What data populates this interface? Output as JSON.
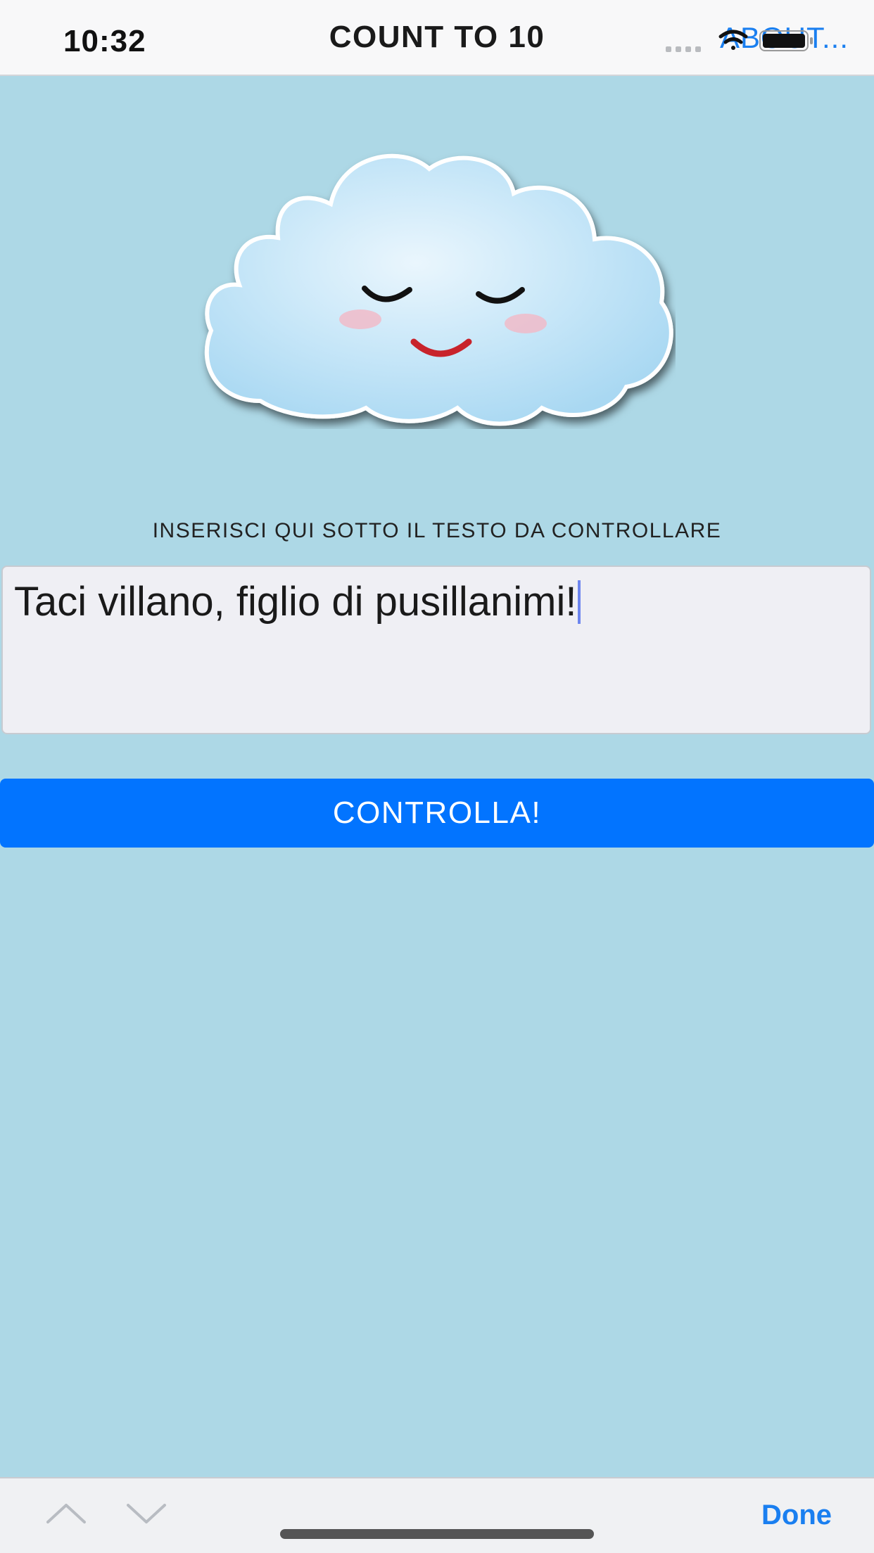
{
  "status_bar": {
    "time": "10:32"
  },
  "nav": {
    "title": "COUNT TO 10",
    "about_label": "ABOUT..."
  },
  "prompt": {
    "label": "INSERISCI QUI SOTTO IL TESTO DA CONTROLLARE"
  },
  "input": {
    "value": "Taci villano, figlio di pusillanimi!"
  },
  "check_button": {
    "label": "CONTROLLA!"
  },
  "accessory_bar": {
    "done_label": "Done",
    "up_icon": "chevron-up-icon",
    "down_icon": "chevron-down-icon"
  },
  "colors": {
    "background": "#add8e6",
    "accent": "#0274ff",
    "link": "#1a7ff0"
  }
}
